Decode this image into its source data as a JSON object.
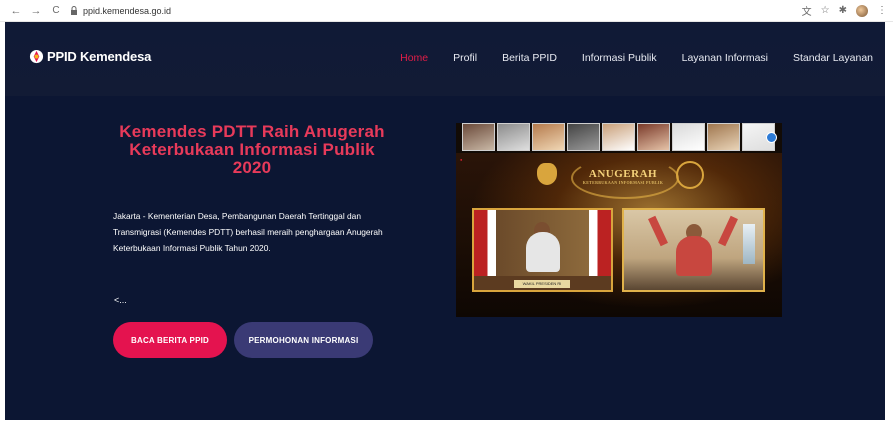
{
  "browser": {
    "url": "ppid.kemendesa.go.id",
    "back_icon": "←",
    "forward_icon": "→",
    "reload_icon": "C",
    "tools": [
      "translate-icon",
      "star-icon",
      "extensions-icon",
      "profile-avatar",
      "menu-icon"
    ]
  },
  "site": {
    "brand": "PPID Kemendesa",
    "nav": [
      {
        "label": "Home",
        "active": true
      },
      {
        "label": "Profil",
        "active": false
      },
      {
        "label": "Berita PPID",
        "active": false
      },
      {
        "label": "Informasi Publik",
        "active": false
      },
      {
        "label": "Layanan Informasi",
        "active": false
      },
      {
        "label": "Standar Layanan",
        "active": false
      }
    ],
    "hero": {
      "title": "Kemendes PDTT Raih Anugerah Keterbukaan Informasi Publik 2020",
      "body": "Jakarta - Kementerian Desa, Pembangunan Daerah Tertinggal dan Transmigrasi (Kemendes PDTT) berhasil meraih penghargaan Anugerah Keterbukaan Informasi Publik Tahun 2020.",
      "more": "<...",
      "primary_button": "BACA BERITA PPID",
      "secondary_button": "PERMOHONAN INFORMASI"
    },
    "video": {
      "banner_title": "ANUGERAH",
      "banner_subtitle": "KETERBUKAAN INFORMASI PUBLIK",
      "caption": "WAKIL PRESIDEN RI"
    }
  },
  "colors": {
    "site_bg": "#0c1633",
    "accent": "#e4134f",
    "title": "#e83a5a",
    "secondary_button": "#3a3a75"
  }
}
